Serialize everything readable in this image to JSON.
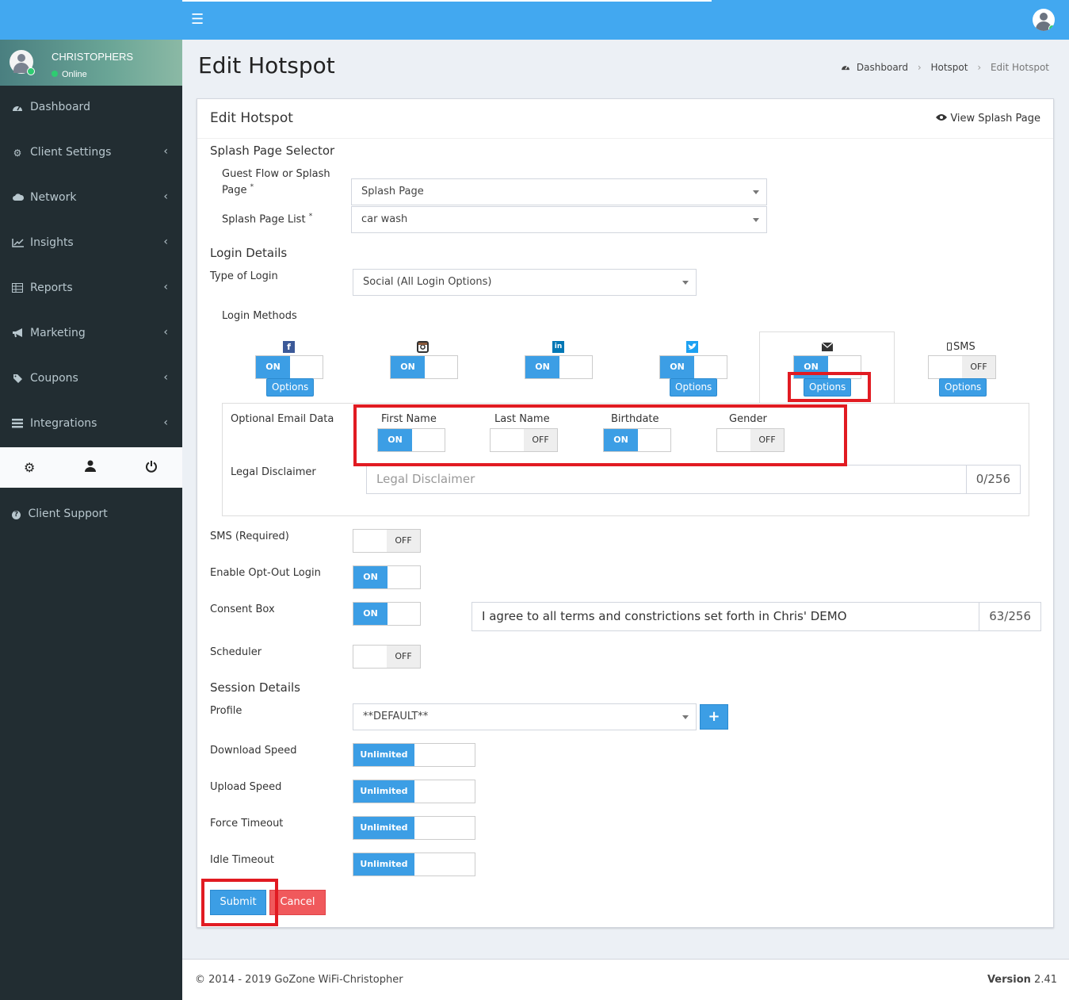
{
  "header": {
    "menu_icon": "hamburger-icon",
    "avatar": "user-avatar"
  },
  "user": {
    "name": "CHRISTOPHERS",
    "status": "Online"
  },
  "sidebar": {
    "items": [
      {
        "label": "Dashboard",
        "icon": "dashboard-icon",
        "arrow": ""
      },
      {
        "label": "Client Settings",
        "icon": "gear-icon",
        "arrow": "‹"
      },
      {
        "label": "Network",
        "icon": "cloud-icon",
        "arrow": "‹"
      },
      {
        "label": "Insights",
        "icon": "chart-line-icon",
        "arrow": "‹"
      },
      {
        "label": "Reports",
        "icon": "table-icon",
        "arrow": "‹"
      },
      {
        "label": "Marketing",
        "icon": "bullhorn-icon",
        "arrow": "‹"
      },
      {
        "label": "Coupons",
        "icon": "tag-icon",
        "arrow": "‹"
      },
      {
        "label": "Integrations",
        "icon": "list-icon",
        "arrow": "‹"
      }
    ],
    "support": "Client Support"
  },
  "page": {
    "title": "Edit Hotspot",
    "breadcrumb": [
      "Dashboard",
      "Hotspot",
      "Edit Hotspot"
    ]
  },
  "box": {
    "title": "Edit Hotspot",
    "view_splash": "View Splash Page",
    "splash_selector": {
      "title": "Splash Page Selector",
      "guest_flow_label_1": "Guest Flow or Splash",
      "guest_flow_label_2": "Page",
      "guest_flow_value": "Splash Page",
      "list_label": "Splash Page List",
      "list_value": "car wash",
      "required_mark": "*"
    },
    "login": {
      "title": "Login Details",
      "type_label": "Type of Login",
      "type_value": "Social (All Login Options)",
      "methods_label": "Login Methods",
      "methods": [
        {
          "icon": "facebook-icon",
          "state": "ON",
          "options": "Options"
        },
        {
          "icon": "instagram-icon",
          "state": "ON"
        },
        {
          "icon": "linkedin-icon",
          "state": "ON"
        },
        {
          "icon": "twitter-icon",
          "state": "ON",
          "options": "Options"
        },
        {
          "icon": "envelope-icon",
          "state": "ON",
          "options": "Options"
        },
        {
          "icon": "mobile-icon",
          "name": "SMS",
          "state": "OFF",
          "options": "Options"
        }
      ]
    },
    "email_options": {
      "optional_label": "Optional Email Data",
      "fields": [
        {
          "name": "First Name",
          "state": "ON"
        },
        {
          "name": "Last Name",
          "state": "OFF"
        },
        {
          "name": "Birthdate",
          "state": "ON"
        },
        {
          "name": "Gender",
          "state": "OFF"
        }
      ],
      "disclaimer_label": "Legal Disclaimer",
      "disclaimer_placeholder": "Legal Disclaimer",
      "disclaimer_count": "0/256"
    },
    "settings": {
      "sms_label": "SMS (Required)",
      "sms_state": "OFF",
      "optout_label": "Enable Opt-Out Login",
      "optout_state": "ON",
      "consent_label": "Consent Box",
      "consent_state": "ON",
      "consent_text": "I agree to all terms and constrictions set forth in Chris' DEMO",
      "consent_count": "63/256",
      "scheduler_label": "Scheduler",
      "scheduler_state": "OFF"
    },
    "session": {
      "title": "Session Details",
      "profile_label": "Profile",
      "profile_value": "**DEFAULT**",
      "add_icon": "plus-icon",
      "download_label": "Download Speed",
      "download_value": "Unlimited",
      "upload_label": "Upload Speed",
      "upload_value": "Unlimited",
      "force_label": "Force Timeout",
      "force_value": "Unlimited",
      "idle_label": "Idle Timeout",
      "idle_value": "Unlimited"
    },
    "actions": {
      "submit": "Submit",
      "cancel": "Cancel"
    }
  },
  "footer": {
    "copyright": "© 2014 - 2019 GoZone WiFi-Christopher",
    "version_label": "Version",
    "version": "2.41"
  },
  "colors": {
    "primary": "#3c9ee5",
    "topbar": "#42a8f0",
    "sidebar": "#222d32",
    "danger": "#f0595c",
    "highlight": "#e11b22"
  }
}
